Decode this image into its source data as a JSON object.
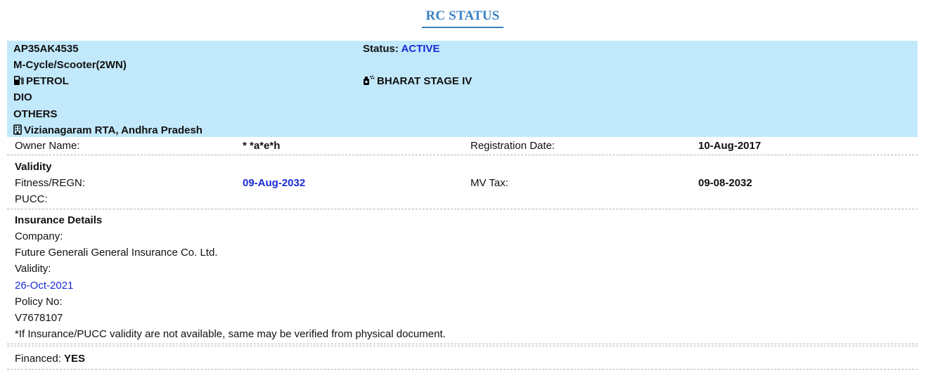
{
  "page": {
    "title": "RC STATUS"
  },
  "vehicle": {
    "reg_no": "AP35AK4535",
    "status_label": "Status:",
    "status_value": "ACTIVE",
    "vehicle_class": "M-Cycle/Scooter(2WN)",
    "fuel": "PETROL",
    "emission_norm": "BHARAT STAGE IV",
    "model": "DIO",
    "maker": "OTHERS",
    "rto": "Vizianagaram RTA, Andhra Pradesh"
  },
  "owner": {
    "owner_label": "Owner Name:",
    "owner_value": "* *a*e*h",
    "reg_date_label": "Registration Date:",
    "reg_date_value": "10-Aug-2017"
  },
  "validity": {
    "heading": "Validity",
    "fitness_label": "Fitness/REGN:",
    "fitness_value": "09-Aug-2032",
    "mvtax_label": "MV Tax:",
    "mvtax_value": "09-08-2032",
    "pucc_label": "PUCC:"
  },
  "insurance": {
    "heading": "Insurance Details",
    "company_label": "Company:",
    "company_value": "Future Generali General Insurance Co. Ltd.",
    "validity_label": "Validity:",
    "validity_value": "26-Oct-2021",
    "policy_label": "Policy No:",
    "policy_value": "V7678107",
    "note": "*If Insurance/PUCC validity are not available, same may be verified from physical document."
  },
  "finance": {
    "label": "Financed:",
    "value": "YES"
  },
  "colors": {
    "title": "#3a82c4",
    "banner": "#c2e9fb",
    "highlight": "#1a2ad6"
  },
  "icons": [
    "fuel-pump-icon",
    "emission-spray-icon",
    "building-icon"
  ]
}
